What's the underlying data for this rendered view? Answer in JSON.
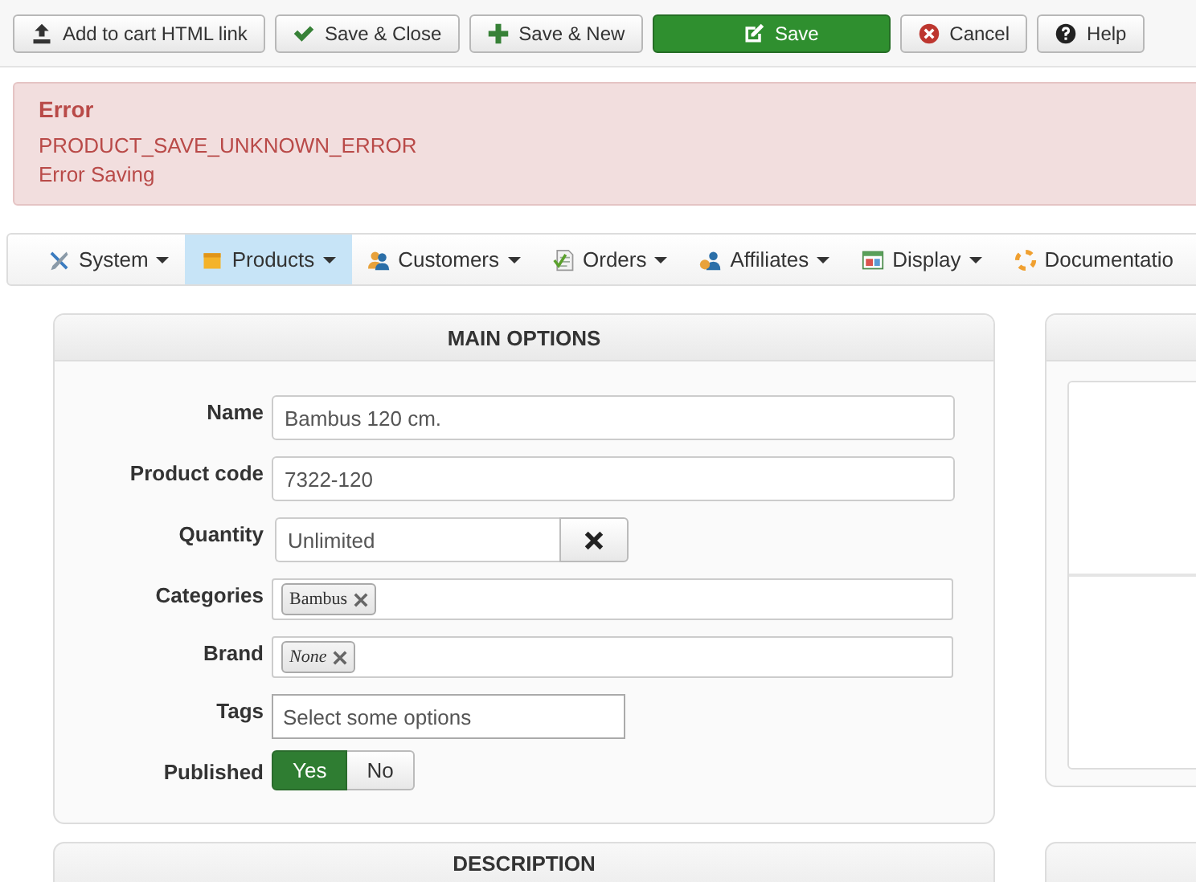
{
  "toolbar": [
    {
      "label": "Add to cart HTML link",
      "kind": "default"
    },
    {
      "label": "Save & Close",
      "kind": "default"
    },
    {
      "label": "Save & New",
      "kind": "default"
    },
    {
      "label": "Save",
      "kind": "primary"
    },
    {
      "label": "Cancel",
      "kind": "default"
    },
    {
      "label": "Help",
      "kind": "default"
    }
  ],
  "alert": {
    "title": "Error",
    "messages": [
      "PRODUCT_SAVE_UNKNOWN_ERROR",
      "Error Saving"
    ]
  },
  "menu": [
    {
      "label": "System",
      "selected": false
    },
    {
      "label": "Products",
      "selected": true
    },
    {
      "label": "Customers",
      "selected": false
    },
    {
      "label": "Orders",
      "selected": false
    },
    {
      "label": "Affiliates",
      "selected": false
    },
    {
      "label": "Display",
      "selected": false
    },
    {
      "label": "Documentatio",
      "selected": false
    }
  ],
  "main_options": {
    "title": "MAIN OPTIONS",
    "fields": [
      {
        "kind": "text",
        "label": "Name",
        "value": "Bambus 120 cm."
      },
      {
        "kind": "text",
        "label": "Product code",
        "value": "7322-120"
      },
      {
        "kind": "quantity",
        "label": "Quantity",
        "value": "Unlimited"
      },
      {
        "kind": "chips",
        "label": "Categories",
        "chips": [
          {
            "text": "Bambus",
            "italic": false
          }
        ]
      },
      {
        "kind": "chips",
        "label": "Brand",
        "chips": [
          {
            "text": "None",
            "italic": true
          }
        ]
      },
      {
        "kind": "select",
        "label": "Tags",
        "placeholder": "Select some options"
      },
      {
        "kind": "toggle",
        "label": "Published",
        "options": [
          {
            "label": "Yes",
            "selected": true
          },
          {
            "label": "No",
            "selected": false
          }
        ]
      }
    ]
  },
  "description": {
    "title": "DESCRIPTION"
  }
}
